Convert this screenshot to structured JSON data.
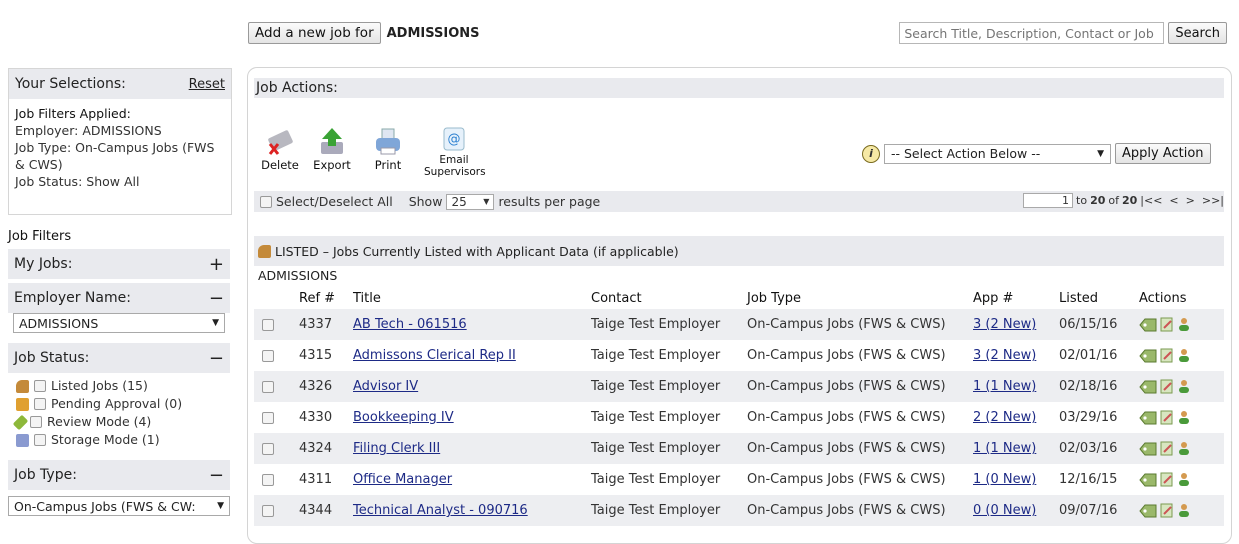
{
  "topbar": {
    "add_job_label": "Add a new job for",
    "employer": "ADMISSIONS",
    "search_placeholder": "Search Title, Description, Contact or Job",
    "search_label": "Search"
  },
  "selections": {
    "title": "Your Selections:",
    "reset": "Reset",
    "heading": "Job Filters Applied:",
    "employer": "Employer: ADMISSIONS",
    "job_type": "Job Type: On-Campus Jobs (FWS & CWS)",
    "job_status": "Job Status: Show All"
  },
  "filters": {
    "title": "Job Filters",
    "my_jobs": "My Jobs:",
    "employer_name": "Employer Name:",
    "employer_value": "ADMISSIONS",
    "job_status": "Job Status:",
    "status_items": [
      {
        "label": "Listed Jobs (15)",
        "color": "#c48a3a"
      },
      {
        "label": "Pending Approval (0)",
        "color": "#e0a030"
      },
      {
        "label": "Review Mode (4)",
        "color": "#8db83a"
      },
      {
        "label": "Storage Mode (1)",
        "color": "#8a9ad0"
      }
    ],
    "job_type": "Job Type:",
    "job_type_value": "On-Campus Jobs (FWS & CW:"
  },
  "actions": {
    "title": "Job Actions:",
    "tools": [
      {
        "label": "Delete",
        "icon": "delete-icon"
      },
      {
        "label": "Export",
        "icon": "export-icon"
      },
      {
        "label": "Print",
        "icon": "print-icon"
      },
      {
        "label": "Email Supervisors",
        "icon": "email-icon"
      }
    ],
    "select_placeholder": "-- Select Action Below --",
    "apply_label": "Apply Action"
  },
  "options": {
    "select_all": "Select/Deselect All",
    "show": "Show",
    "per_page": "25",
    "results_per_page": "results per page",
    "page_value": "1",
    "page_to": "to",
    "page_end": "20",
    "page_of": "of",
    "page_total": "20",
    "nav": "|<<  <  >  >>|"
  },
  "listing": {
    "banner": "LISTED – Jobs Currently Listed with Applicant Data (if applicable)",
    "employer": "ADMISSIONS",
    "columns": [
      "Ref #",
      "Title",
      "Contact",
      "Job Type",
      "App #",
      "Listed",
      "Actions"
    ],
    "rows": [
      {
        "ref": "4337",
        "title": "AB Tech - 061516",
        "contact": "Taige Test Employer",
        "type": "On-Campus Jobs (FWS & CWS)",
        "app": "3 (2 New)",
        "listed": "06/15/16"
      },
      {
        "ref": "4315",
        "title": "Admissons Clerical Rep II",
        "contact": "Taige Test Employer",
        "type": "On-Campus Jobs (FWS & CWS)",
        "app": "3 (2 New)",
        "listed": "02/01/16"
      },
      {
        "ref": "4326",
        "title": "Advisor IV",
        "contact": "Taige Test Employer",
        "type": "On-Campus Jobs (FWS & CWS)",
        "app": "1 (1 New)",
        "listed": "02/18/16"
      },
      {
        "ref": "4330",
        "title": "Bookkeeping IV",
        "contact": "Taige Test Employer",
        "type": "On-Campus Jobs (FWS & CWS)",
        "app": "2 (2 New)",
        "listed": "03/29/16"
      },
      {
        "ref": "4324",
        "title": "Filing Clerk III",
        "contact": "Taige Test Employer",
        "type": "On-Campus Jobs (FWS & CWS)",
        "app": "1 (1 New)",
        "listed": "02/03/16"
      },
      {
        "ref": "4311",
        "title": "Office Manager",
        "contact": "Taige Test Employer",
        "type": "On-Campus Jobs (FWS & CWS)",
        "app": "1 (0 New)",
        "listed": "12/16/15"
      },
      {
        "ref": "4344",
        "title": "Technical Analyst - 090716",
        "contact": "Taige Test Employer",
        "type": "On-Campus Jobs (FWS & CWS)",
        "app": "0 (0 New)",
        "listed": "09/07/16"
      }
    ]
  }
}
